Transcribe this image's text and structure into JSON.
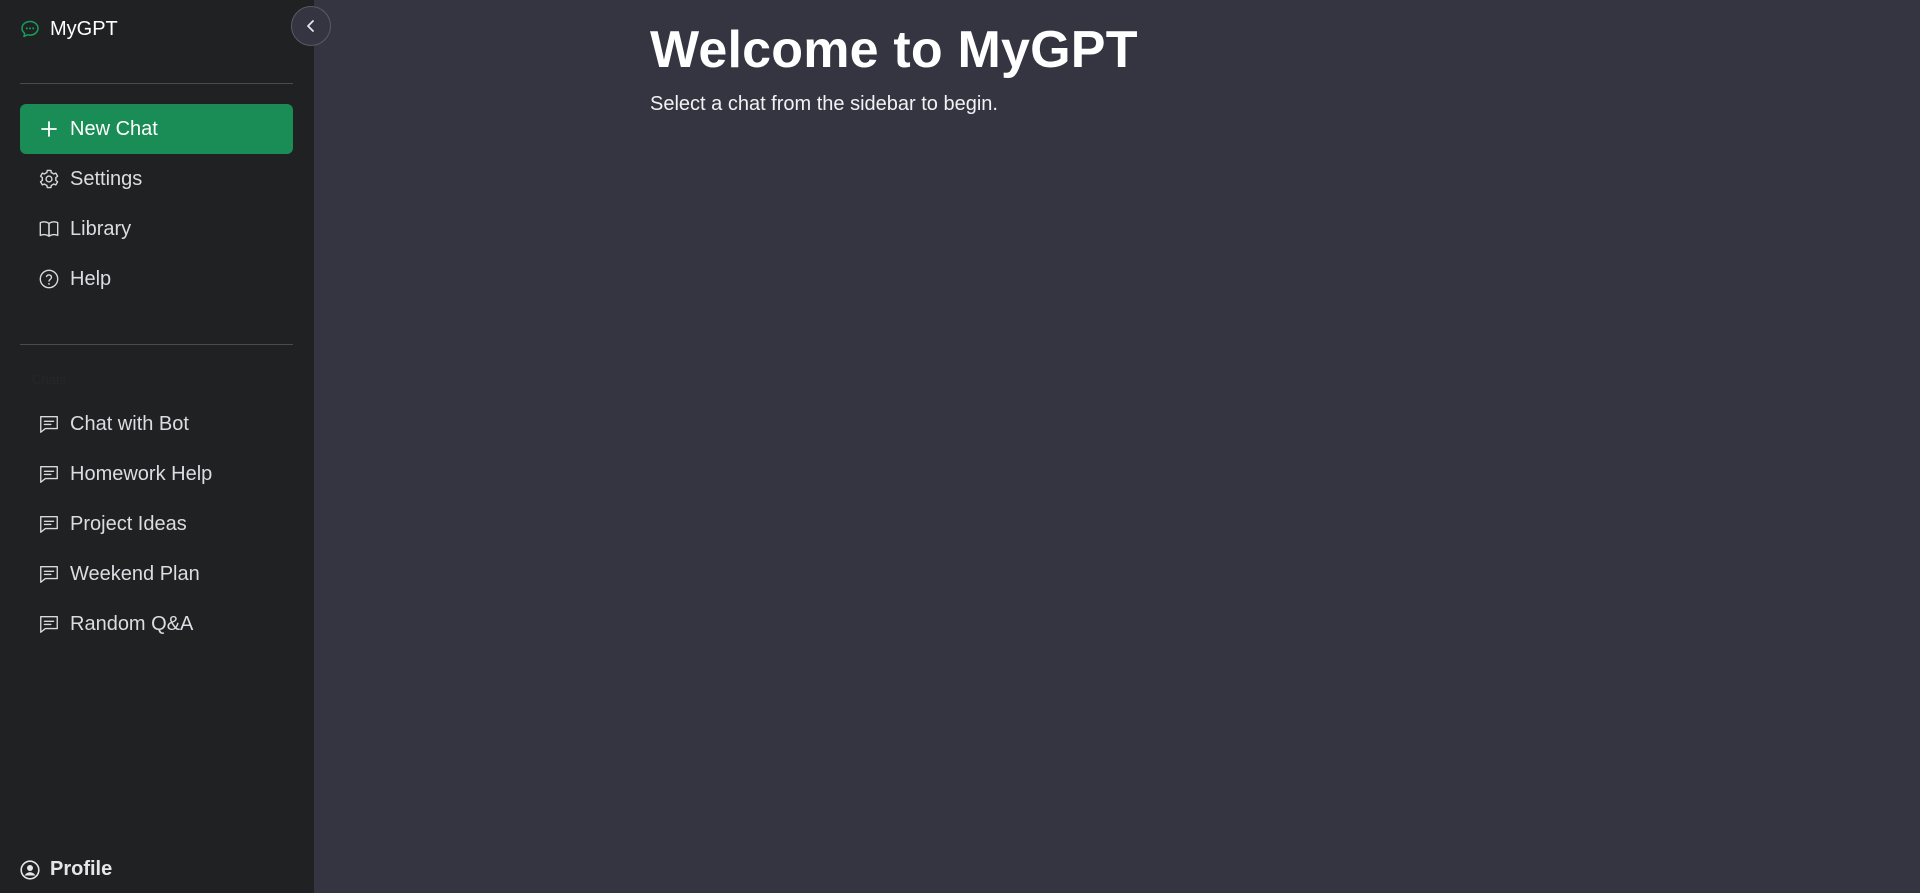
{
  "app": {
    "title": "MyGPT",
    "accent_color": "#1a8c55",
    "sidebar_bg": "#202123",
    "main_bg": "#353541"
  },
  "sidebar": {
    "brand_icon": "chat-bubble-icon",
    "collapse_icon": "chevron-left-icon",
    "new_chat": {
      "label": "New Chat",
      "icon": "plus-icon"
    },
    "menu": [
      {
        "label": "Settings",
        "icon": "gear-icon"
      },
      {
        "label": "Library",
        "icon": "book-icon"
      },
      {
        "label": "Help",
        "icon": "help-circle-icon"
      }
    ],
    "chats_section_label": "Chats",
    "chats": [
      {
        "label": "Chat with Bot",
        "icon": "message-icon"
      },
      {
        "label": "Homework Help",
        "icon": "message-icon"
      },
      {
        "label": "Project Ideas",
        "icon": "message-icon"
      },
      {
        "label": "Weekend Plan",
        "icon": "message-icon"
      },
      {
        "label": "Random Q&A",
        "icon": "message-icon"
      }
    ],
    "profile": {
      "label": "Profile",
      "icon": "user-circle-icon"
    }
  },
  "main": {
    "title": "Welcome to MyGPT",
    "subtitle": "Select a chat from the sidebar to begin."
  }
}
